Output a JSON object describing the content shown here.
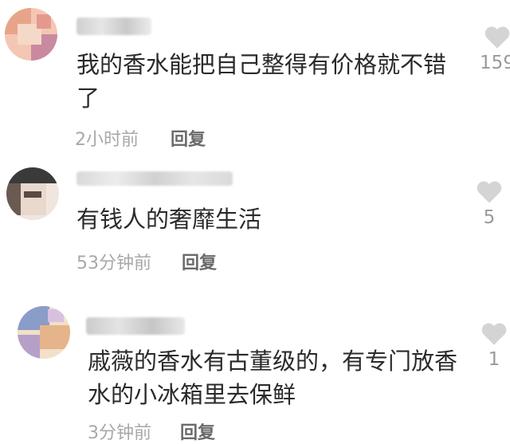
{
  "comments": [
    {
      "text_lines": [
        "我的香水能把自己整得有价格就不错",
        "了"
      ],
      "time": "2小时前",
      "reply_label": "回复",
      "likes": "159",
      "avatar_colors": [
        "#e8a48a",
        "#f3c7b4",
        "#c98aa0",
        "#f5d9c8"
      ],
      "username_color": "#d8d8d8"
    },
    {
      "text_lines": [
        "有钱人的奢靡生活"
      ],
      "time": "53分钟前",
      "reply_label": "回复",
      "likes": "5",
      "avatar_colors": [
        "#3a3a3a",
        "#e9d8cc",
        "#6b5a52",
        "#f0e6df"
      ],
      "username_color": "#dcdcdc"
    },
    {
      "text_lines": [
        "戚薇的香水有古董级的，有专门放香",
        "水的小冰箱里去保鲜"
      ],
      "time": "3分钟前",
      "reply_label": "回复",
      "likes": "1",
      "avatar_colors": [
        "#8a9cc8",
        "#e6b48a",
        "#b6a0c8",
        "#f2e0c8"
      ],
      "username_color": "#d6d6d6"
    }
  ],
  "icons": {
    "like": "heart-icon"
  },
  "colors": {
    "text": "#2a2a2a",
    "meta": "#a8a8a8",
    "reply": "#6a6a6a",
    "heart": "#d4d4d4"
  }
}
